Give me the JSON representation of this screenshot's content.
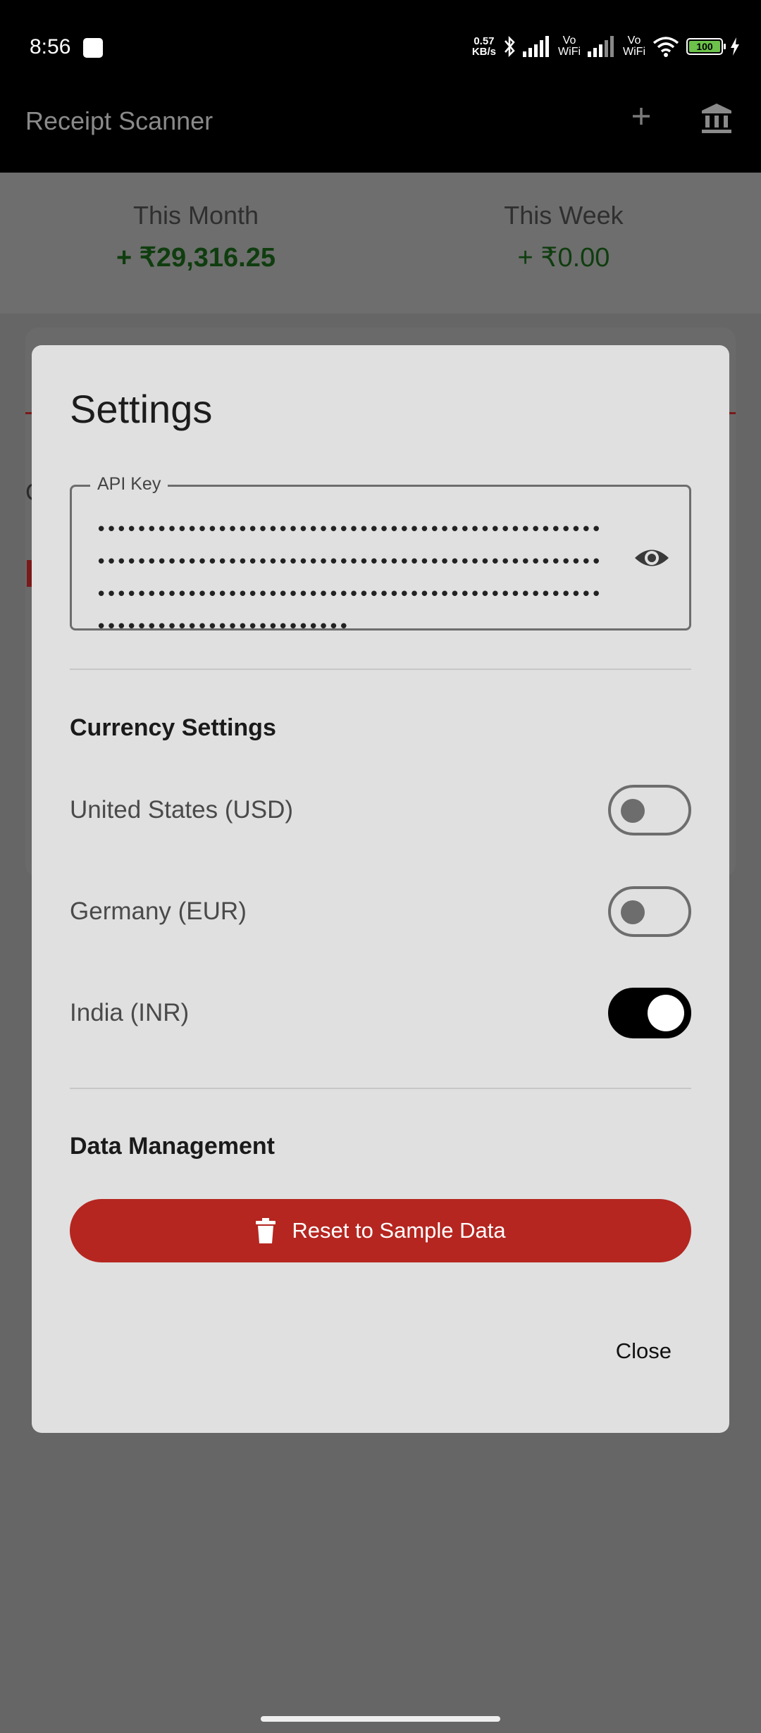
{
  "status_bar": {
    "time": "8:56",
    "net_speed_value": "0.57",
    "net_speed_unit": "KB/s",
    "vowifi_1_top": "Vo",
    "vowifi_1_bottom": "WiFi",
    "vowifi_2_top": "Vo",
    "vowifi_2_bottom": "WiFi",
    "battery_level": "100"
  },
  "app_bar": {
    "title": "Receipt Scanner",
    "add_icon": "plus-icon",
    "bank_icon": "bank-icon"
  },
  "summary": {
    "month_label": "This Month",
    "month_value": "+ ₹29,316.25",
    "week_label": "This Week",
    "week_value": "+ ₹0.00",
    "value_color": "#0f3d0f"
  },
  "background": {
    "partial_letter": "C"
  },
  "dialog": {
    "title": "Settings",
    "api_key": {
      "label": "API Key",
      "masked_value": "•••••••••••••••••••••••••••••••••••••••••••••••••••••••••••••••••••••••••••••••••••••••••••••••••••••••••••••••••••••••••••••••••••••••••••••••••••••••••••••••••••••••••••••••",
      "visibility_icon": "eye-icon"
    },
    "currency_section": {
      "title": "Currency Settings",
      "options": [
        {
          "label": "United States (USD)",
          "enabled": false
        },
        {
          "label": "Germany (EUR)",
          "enabled": false
        },
        {
          "label": "India (INR)",
          "enabled": true
        }
      ]
    },
    "data_section": {
      "title": "Data Management",
      "reset_label": "Reset to Sample Data",
      "reset_icon": "trash-icon",
      "reset_color": "#b52620"
    },
    "close_label": "Close"
  }
}
